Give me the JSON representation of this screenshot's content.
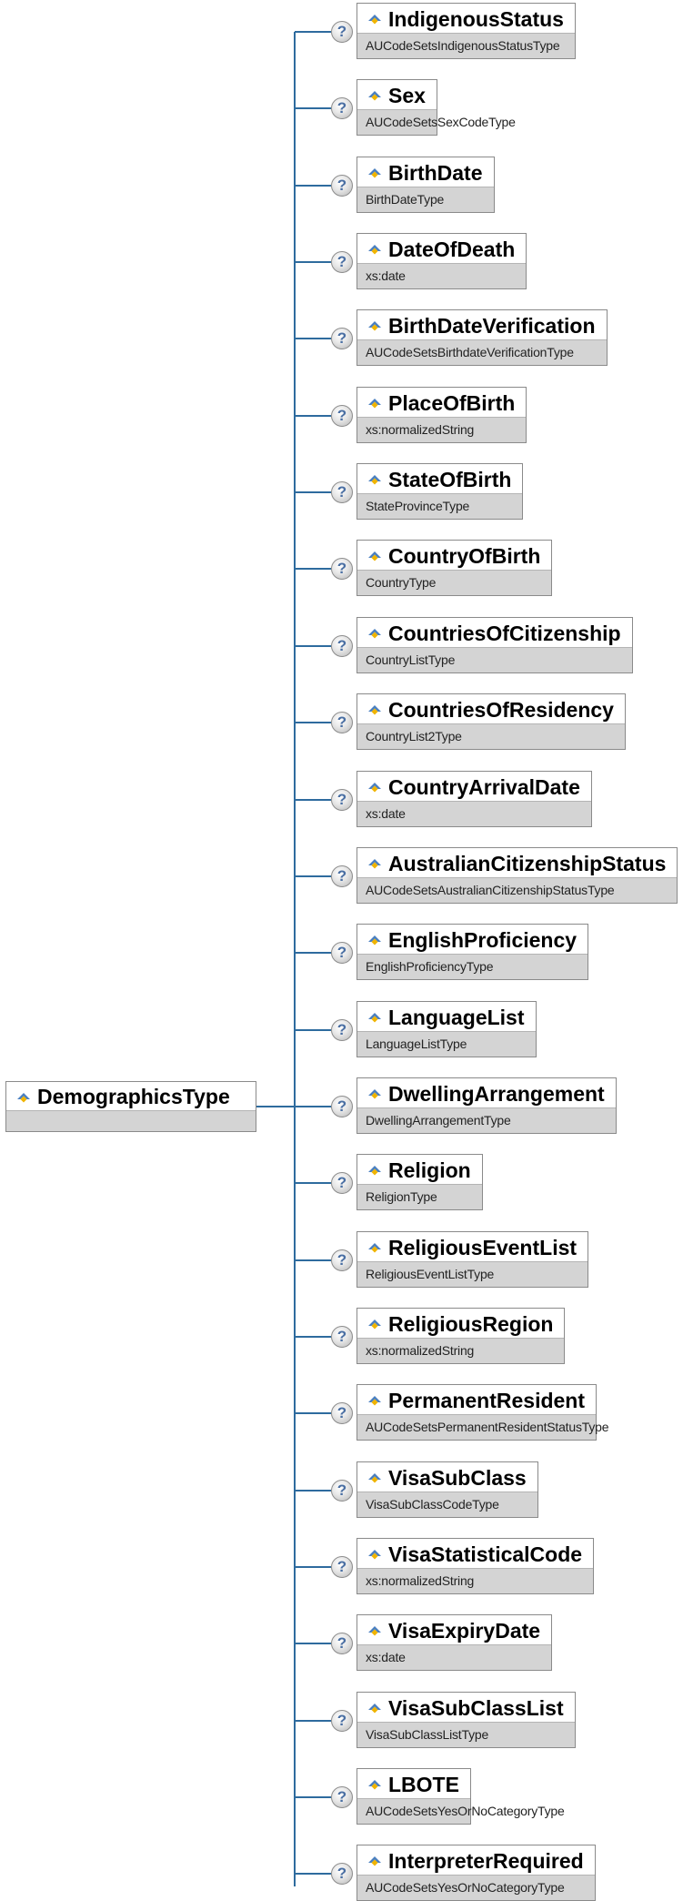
{
  "root": {
    "name": "DemographicsType",
    "icon": "element-icon"
  },
  "help_icon_glyph": "?",
  "elements": [
    {
      "name": "IndigenousStatus",
      "type": "AUCodeSetsIndigenousStatusType"
    },
    {
      "name": "Sex",
      "type": "AUCodeSetsSexCodeType"
    },
    {
      "name": "BirthDate",
      "type": "BirthDateType"
    },
    {
      "name": "DateOfDeath",
      "type": "xs:date"
    },
    {
      "name": "BirthDateVerification",
      "type": "AUCodeSetsBirthdateVerificationType"
    },
    {
      "name": "PlaceOfBirth",
      "type": "xs:normalizedString"
    },
    {
      "name": "StateOfBirth",
      "type": "StateProvinceType"
    },
    {
      "name": "CountryOfBirth",
      "type": "CountryType"
    },
    {
      "name": "CountriesOfCitizenship",
      "type": "CountryListType"
    },
    {
      "name": "CountriesOfResidency",
      "type": "CountryList2Type"
    },
    {
      "name": "CountryArrivalDate",
      "type": "xs:date"
    },
    {
      "name": "AustralianCitizenshipStatus",
      "type": "AUCodeSetsAustralianCitizenshipStatusType"
    },
    {
      "name": "EnglishProficiency",
      "type": "EnglishProficiencyType"
    },
    {
      "name": "LanguageList",
      "type": "LanguageListType"
    },
    {
      "name": "DwellingArrangement",
      "type": "DwellingArrangementType"
    },
    {
      "name": "Religion",
      "type": "ReligionType"
    },
    {
      "name": "ReligiousEventList",
      "type": "ReligiousEventListType"
    },
    {
      "name": "ReligiousRegion",
      "type": "xs:normalizedString"
    },
    {
      "name": "PermanentResident",
      "type": "AUCodeSetsPermanentResidentStatusType"
    },
    {
      "name": "VisaSubClass",
      "type": "VisaSubClassCodeType"
    },
    {
      "name": "VisaStatisticalCode",
      "type": "xs:normalizedString"
    },
    {
      "name": "VisaExpiryDate",
      "type": "xs:date"
    },
    {
      "name": "VisaSubClassList",
      "type": "VisaSubClassListType"
    },
    {
      "name": "LBOTE",
      "type": "AUCodeSetsYesOrNoCategoryType"
    },
    {
      "name": "InterpreterRequired",
      "type": "AUCodeSetsYesOrNoCategoryType"
    }
  ]
}
